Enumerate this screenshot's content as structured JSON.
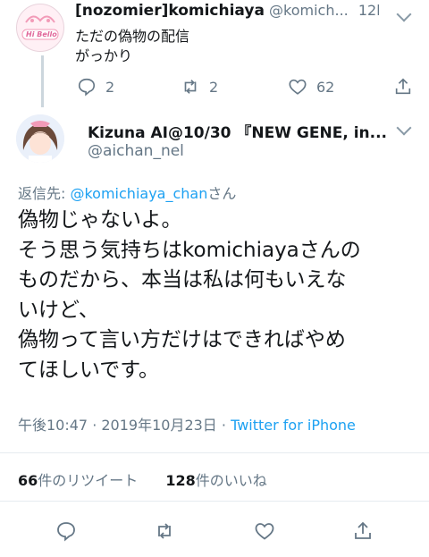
{
  "parent_tweet": {
    "display_name": "[nozomier]komichiaya",
    "handle": "@komich...",
    "time": "12h",
    "lines": [
      "ただの偽物の配信",
      "がっかり"
    ],
    "avatar_logo_text": "Hi Bello",
    "replies": "2",
    "retweets": "2",
    "likes": "62"
  },
  "main_tweet": {
    "display_name": "Kizuna AI@10/30 『NEW GENE, in...",
    "handle": "@aichan_nel",
    "reply_to_prefix": "返信先: ",
    "reply_to_handle": "@komichiaya_chan",
    "reply_to_suffix": "さん",
    "text_lines": [
      "偽物じゃないよ。",
      "そう思う気持ちはkomichiayaさんの",
      "ものだから、本当は私は何もいえな",
      "いけど、",
      "偽物って言い方だけはできればやめ",
      "てほしいです。"
    ],
    "timestamp": "午後10:47 · 2019年10月23日 · ",
    "source": "Twitter for iPhone",
    "retweet_count": "66",
    "retweet_label": "件のリツイート",
    "like_count": "128",
    "like_label": "件のいいね"
  },
  "colors": {
    "accent": "#1da1f2",
    "muted": "#657786",
    "divider": "#e6ecf0",
    "verified": "#1da1f2"
  },
  "icons": [
    "reply-icon",
    "retweet-icon",
    "like-icon",
    "share-icon",
    "chevron-down-icon",
    "verified-icon"
  ]
}
